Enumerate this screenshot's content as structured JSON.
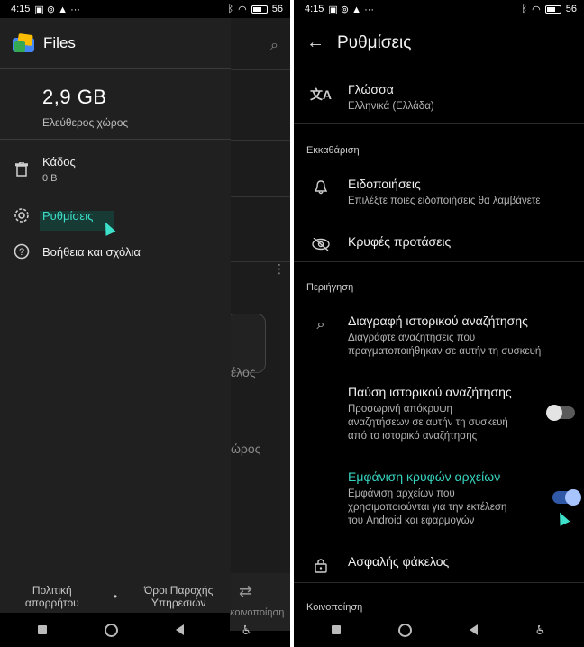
{
  "status": {
    "time": "4:15",
    "battery": "56"
  },
  "left": {
    "app_title": "Files",
    "storage": {
      "size": "2,9 GB",
      "label": "Ελεύθερος χώρος"
    },
    "trash": {
      "label": "Κάδος",
      "sub": "0 B"
    },
    "settings_label": "Ρυθμίσεις",
    "help_label": "Βοήθεια και σχόλια",
    "footer": {
      "privacy": "Πολιτική απορρήτου",
      "terms": "Όροι Παροχής Υπηρεσιών"
    },
    "background": {
      "text1": "έλος",
      "text2": "ώρος",
      "share": "κοινοποίηση"
    }
  },
  "right": {
    "title": "Ρυθμίσεις",
    "language": {
      "title": "Γλώσσα",
      "value": "Ελληνικά (Ελλάδα)"
    },
    "section_cleanup": "Εκκαθάριση",
    "notifications": {
      "title": "Ειδοποιήσεις",
      "sub": "Επιλέξτε ποιες ειδοποιήσεις θα λαμβάνετε"
    },
    "hidden_suggestions": {
      "title": "Κρυφές προτάσεις"
    },
    "section_browse": "Περιήγηση",
    "clear_history": {
      "title": "Διαγραφή ιστορικού αναζήτησης",
      "sub": "Διαγράφτε αναζητήσεις που πραγματοποιήθηκαν σε αυτήν τη συσκευή"
    },
    "pause_history": {
      "title": "Παύση ιστορικού αναζήτησης",
      "sub": "Προσωρινή απόκρυψη αναζητήσεων σε αυτήν τη συσκευή από το ιστορικό αναζήτησης",
      "enabled": false
    },
    "show_hidden": {
      "title": "Εμφάνιση κρυφών αρχείων",
      "sub": "Εμφάνιση αρχείων που χρησιμοποιούνται για την εκτέλεση του Android και εφαρμογών",
      "enabled": true
    },
    "safe_folder": {
      "title": "Ασφαλής φάκελος"
    },
    "section_share": "Κοινοποίηση"
  },
  "colors": {
    "accent": "#3de0c9",
    "switch_on": "#2f58a6",
    "drawer_bg": "#202020"
  }
}
